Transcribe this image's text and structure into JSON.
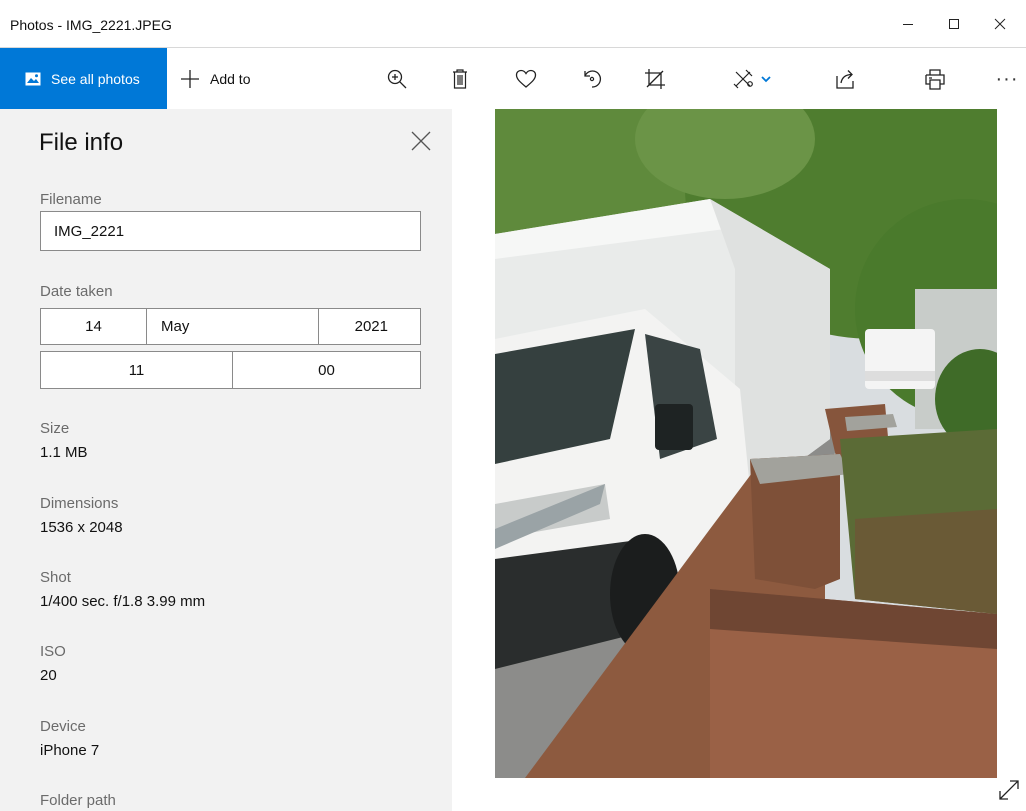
{
  "window": {
    "title": "Photos - IMG_2221.JPEG",
    "minimize_icon": "minimize-icon",
    "maximize_icon": "maximize-icon",
    "close_icon": "close-icon"
  },
  "toolbar": {
    "see_all_label": "See all photos",
    "add_to_label": "Add to",
    "more_label": "···",
    "icons": [
      "photos-icon",
      "plus-icon",
      "zoom-icon",
      "delete-icon",
      "heart-icon",
      "rotate-icon",
      "crop-icon",
      "edit-icon",
      "chevron-down-icon",
      "share-icon",
      "print-icon"
    ],
    "accent": "#0078d7"
  },
  "file_info": {
    "title": "File info",
    "filename_label": "Filename",
    "filename": "IMG_2221",
    "date_label": "Date taken",
    "day": "14",
    "month": "May",
    "year": "2021",
    "hour": "11",
    "minute": "00",
    "size_label": "Size",
    "size": "1.1 MB",
    "dimensions_label": "Dimensions",
    "dimensions": "1536 x 2048",
    "shot_label": "Shot",
    "shot": "1/400 sec. f/1.8 3.99 mm",
    "iso_label": "ISO",
    "iso": "20",
    "device_label": "Device",
    "device": "iPhone 7",
    "folder_label": "Folder path"
  },
  "photo": {
    "icon": "fullscreen-icon"
  }
}
